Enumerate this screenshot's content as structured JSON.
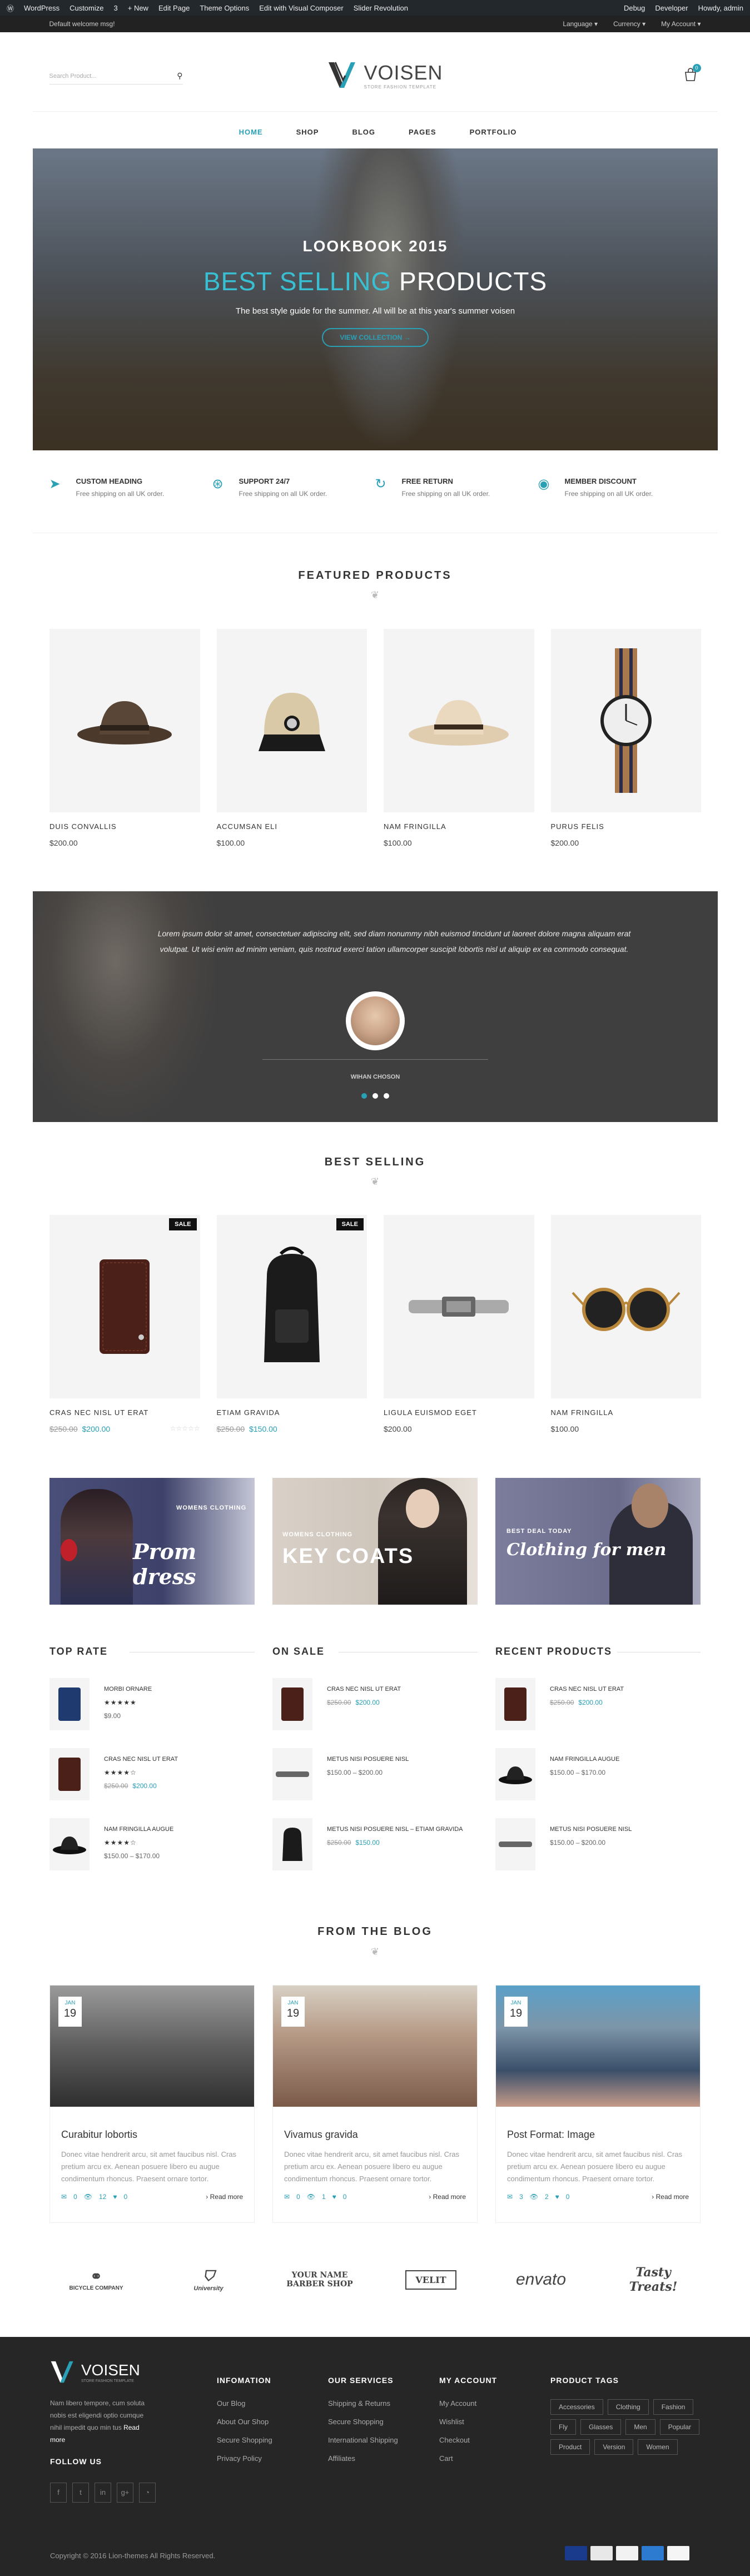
{
  "adminbar": {
    "items": [
      "WordPress",
      "Customize",
      "3",
      "+ New",
      "Edit Page",
      "Theme Options",
      "Edit with Visual Composer",
      "Slider Revolution"
    ],
    "right": [
      "Debug",
      "Developer",
      "Howdy, admin"
    ]
  },
  "topbar": {
    "welcome": "Default welcome msg!",
    "language": "Language",
    "currency": "Currency",
    "account": "My Account"
  },
  "header": {
    "search_placeholder": "Search Product...",
    "logo_name": "VOISEN",
    "logo_tagline": "STORE FASHION TEMPLATE",
    "cart_count": "0"
  },
  "nav": [
    "HOME",
    "SHOP",
    "BLOG",
    "PAGES",
    "PORTFOLIO"
  ],
  "hero": {
    "line1": "LOOKBOOK 2015",
    "line2_accent": "BEST SELLING",
    "line2_rest": "PRODUCTS",
    "line3": "The best style guide for the summer. All will be at this year's summer voisen",
    "button": "VIEW COLLECTION"
  },
  "features": [
    {
      "title": "CUSTOM HEADING",
      "desc": "Free shipping on all UK order.",
      "icon": "plane-icon"
    },
    {
      "title": "SUPPORT 24/7",
      "desc": "Free shipping on all UK order.",
      "icon": "lifebuoy-icon"
    },
    {
      "title": "FREE RETURN",
      "desc": "Free shipping on all UK order.",
      "icon": "return-icon"
    },
    {
      "title": "MEMBER DISCOUNT",
      "desc": "Free shipping on all UK order.",
      "icon": "discount-icon"
    }
  ],
  "featured": {
    "title": "FEATURED PRODUCTS",
    "items": [
      {
        "name": "DUIS CONVALLIS",
        "price": "$200.00"
      },
      {
        "name": "ACCUMSAN ELI",
        "price": "$100.00"
      },
      {
        "name": "NAM FRINGILLA",
        "price": "$100.00"
      },
      {
        "name": "PURUS FELIS",
        "price": "$200.00"
      }
    ]
  },
  "testimonial": {
    "quote": "Lorem ipsum dolor sit amet, consectetuer adipiscing elit, sed diam nonummy nibh euismod tincidunt ut laoreet dolore magna aliquam erat volutpat. Ut wisi enim ad minim veniam, quis nostrud exerci tation ullamcorper suscipit lobortis nisl ut aliquip ex ea commodo consequat.",
    "name": "WIHAN CHOSON"
  },
  "bestselling": {
    "title": "BEST SELLING",
    "sale_label": "SALE",
    "items": [
      {
        "name": "CRAS NEC NISL UT ERAT",
        "old": "$250.00",
        "price": "$200.00"
      },
      {
        "name": "ETIAM GRAVIDA",
        "old": "$250.00",
        "price": "$150.00"
      },
      {
        "name": "LIGULA EUISMOD EGET",
        "old": "",
        "price": "$200.00"
      },
      {
        "name": "NAM FRINGILLA",
        "old": "",
        "price": "$100.00"
      }
    ]
  },
  "banners": [
    {
      "tag": "WOMENS CLOTHING",
      "big": "Prom dress"
    },
    {
      "tag": "WOMENS CLOTHING",
      "big": "KEY COATS"
    },
    {
      "tag": "BEST DEAL TODAY",
      "big": "Clothing for men"
    }
  ],
  "widgets": [
    {
      "title": "TOP RATE",
      "items": [
        {
          "name": "MORBI ORNARE",
          "stars": "★★★★★",
          "price": "$9.00"
        },
        {
          "name": "CRAS NEC NISL UT ERAT",
          "stars": "★★★★☆",
          "old": "$250.00",
          "price": "$200.00"
        },
        {
          "name": "NAM FRINGILLA AUGUE",
          "stars": "★★★★☆",
          "price": "$150.00 – $170.00"
        }
      ]
    },
    {
      "title": "ON SALE",
      "items": [
        {
          "name": "CRAS NEC NISL UT ERAT",
          "old": "$250.00",
          "price": "$200.00"
        },
        {
          "name": "METUS NISI POSUERE NISL",
          "price": "$150.00 – $200.00"
        },
        {
          "name": "METUS NISI POSUERE NISL – ETIAM GRAVIDA",
          "old": "$250.00",
          "price": "$150.00"
        }
      ]
    },
    {
      "title": "RECENT PRODUCTS",
      "items": [
        {
          "name": "CRAS NEC NISL UT ERAT",
          "old": "$250.00",
          "price": "$200.00"
        },
        {
          "name": "NAM FRINGILLA AUGUE",
          "price": "$150.00 – $170.00"
        },
        {
          "name": "METUS NISI POSUERE NISL",
          "price": "$150.00 – $200.00"
        }
      ]
    }
  ],
  "blog": {
    "title": "FROM THE BLOG",
    "month": "JAN",
    "day": "19",
    "excerpt": "Donec vitae hendrerit arcu, sit amet faucibus nisl. Cras pretium arcu ex. Aenean posuere libero eu augue condimentum rhoncus. Praesent ornare tortor.",
    "read_more": "Read more",
    "posts": [
      {
        "title": "Curabitur lobortis",
        "views": "0",
        "comments": "12",
        "likes": "0"
      },
      {
        "title": "Vivamus gravida",
        "views": "0",
        "comments": "1",
        "likes": "0"
      },
      {
        "title": "Post Format: Image",
        "views": "3",
        "comments": "2",
        "likes": "0"
      }
    ]
  },
  "brands": [
    "BICYCLE COMPANY",
    "University",
    "YOUR NAME BARBER SHOP",
    "VELIT",
    "envato",
    "Tasty Treats!"
  ],
  "footer": {
    "logo_name": "VOISEN",
    "logo_tagline": "STORE FASHION TEMPLATE",
    "about": "Nam libero tempore, cum soluta nobis est eligendi optio cumque nihil impedit quo min tus",
    "about_more": "Read more",
    "follow": "FOLLOW US",
    "info_title": "INFOMATION",
    "info": [
      "Our Blog",
      "About Our Shop",
      "Secure Shopping",
      "Privacy Policy"
    ],
    "services_title": "OUR SERVICES",
    "services": [
      "Shipping & Returns",
      "Secure Shopping",
      "International Shipping",
      "Affiliates"
    ],
    "account_title": "MY ACCOUNT",
    "account": [
      "My Account",
      "Wishlist",
      "Checkout",
      "Cart"
    ],
    "tags_title": "PRODUCT TAGS",
    "tags": [
      "Accessories",
      "Clothing",
      "Fashion",
      "Fly",
      "Glasses",
      "Men",
      "Popular",
      "Product",
      "Version",
      "Women"
    ],
    "copyright": "Copyright © 2016 Lion-themes All Rights Reserved."
  }
}
